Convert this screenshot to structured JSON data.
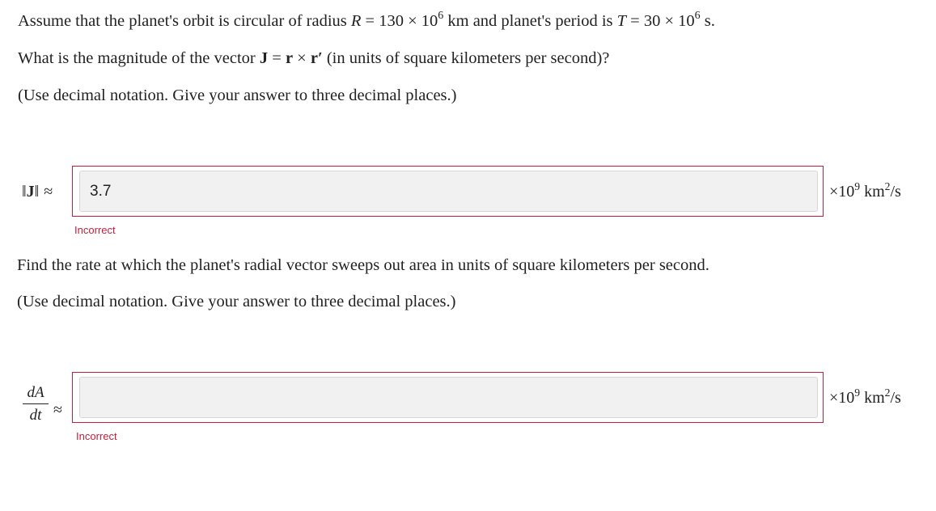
{
  "question1": {
    "part1": "Assume that the planet's orbit is circular of radius ",
    "R_var": "R",
    "R_eq": " = 130 × 10",
    "R_exp": "6",
    "part2": " km and planet's period is ",
    "T_var": "T",
    "T_eq": " = 30 × 10",
    "T_exp": "6",
    "part3": " s."
  },
  "question2": {
    "part1": "What is the magnitude of the vector ",
    "J": "J",
    "eq": " = ",
    "r1": "r",
    "times": " × ",
    "r2": "r′",
    "part2": " (in units of square kilometers per second)?"
  },
  "instruction1": "(Use decimal notation. Give your answer to three decimal places.)",
  "answer1": {
    "label_left": "‖",
    "label_J": "J",
    "label_right": "‖",
    "approx": "≈",
    "value": "3.7",
    "units_prefix": "×10",
    "units_exp": "9",
    "units_mid": " km",
    "units_exp2": "2",
    "units_suffix": "/s",
    "feedback": "Incorrect"
  },
  "question3": "Find the rate at which the planet's radial vector sweeps out area in units of square kilometers per second.",
  "instruction2": "(Use decimal notation. Give your answer to three decimal places.)",
  "answer2": {
    "numerator": "dA",
    "denominator": "dt",
    "approx": "≈",
    "value": "",
    "units_prefix": "×10",
    "units_exp": "9",
    "units_mid": " km",
    "units_exp2": "2",
    "units_suffix": "/s",
    "feedback": "Incorrect"
  },
  "colors": {
    "error": "#c41e3a",
    "input_bg": "#f1f1f1",
    "text": "#222222"
  }
}
